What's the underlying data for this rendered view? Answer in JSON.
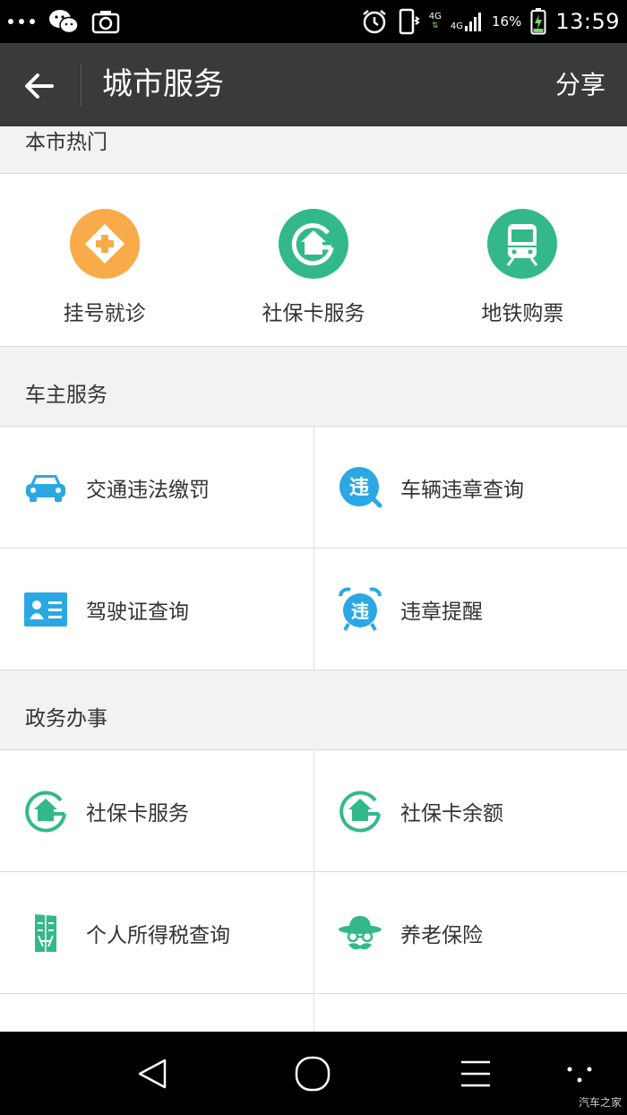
{
  "status_bar": {
    "network_top": "4G",
    "network_bottom": "4G",
    "battery": "16%",
    "time": "13:59"
  },
  "app_bar": {
    "title": "城市服务",
    "share": "分享"
  },
  "sections": {
    "hot": {
      "title": "本市热门",
      "items": [
        {
          "label": "挂号就诊"
        },
        {
          "label": "社保卡服务"
        },
        {
          "label": "地铁购票"
        }
      ]
    },
    "car": {
      "title": "车主服务",
      "items": [
        {
          "label": "交通违法缴罚"
        },
        {
          "label": "车辆违章查询"
        },
        {
          "label": "驾驶证查询"
        },
        {
          "label": "违章提醒"
        }
      ]
    },
    "gov": {
      "title": "政务办事",
      "items": [
        {
          "label": "社保卡服务"
        },
        {
          "label": "社保卡余额"
        },
        {
          "label": "个人所得税查询"
        },
        {
          "label": "养老保险"
        }
      ]
    }
  },
  "icon_glyphs": {
    "violation": "违"
  },
  "watermark": "汽车之家",
  "colors": {
    "orange": "#f9ab4a",
    "green": "#33b989",
    "blue": "#2ba8e3",
    "appbar": "#3a3a3a"
  }
}
